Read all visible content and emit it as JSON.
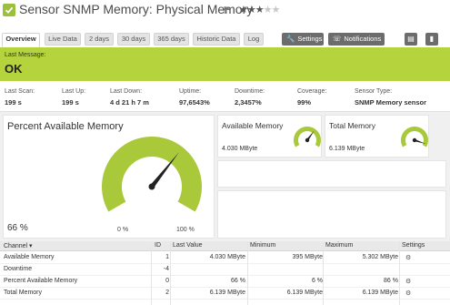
{
  "header": {
    "title": "Sensor SNMP Memory: Physical Memory",
    "status_icon": "check-icon",
    "flag_icon": "flag-icon",
    "priority": {
      "filled": 3,
      "total": 5,
      "filled_glyph": "★★★",
      "empty_glyph": "★★"
    },
    "colors": {
      "status_green": "#9bc03c",
      "banner_green": "#b5d33d",
      "gauge_green": "#a9c83a"
    }
  },
  "tabs": [
    "Overview",
    "Live Data",
    "2 days",
    "30 days",
    "365 days",
    "Historic Data",
    "Log"
  ],
  "toolbar": {
    "settings_label": "Settings",
    "notifications_label": "Notifications",
    "comment_icon": "comment-icon",
    "delete_icon": "trash-icon"
  },
  "banner": {
    "label": "Last Message:",
    "value": "OK"
  },
  "stats": [
    {
      "label": "Last Scan:",
      "value": "199 s"
    },
    {
      "label": "Last Up:",
      "value": "199 s"
    },
    {
      "label": "Last Down:",
      "value": "4 d 21 h 7 m"
    },
    {
      "label": "Uptime:",
      "value": "97,6543%"
    },
    {
      "label": "Downtime:",
      "value": "2,3457%"
    },
    {
      "label": "Coverage:",
      "value": "99%"
    },
    {
      "label": "Sensor Type:",
      "value": "SNMP Memory sensor"
    }
  ],
  "big_gauge": {
    "title": "Percent Available Memory",
    "value_label": "66 %",
    "min_label": "0 %",
    "max_label": "100 %",
    "fraction": 0.66
  },
  "small_gauges": [
    {
      "title": "Available Memory",
      "value": "4.030 MByte",
      "fraction": 0.65
    },
    {
      "title": "Total Memory",
      "value": "6.139 MByte",
      "fraction": 0.95
    }
  ],
  "table": {
    "headers": {
      "channel": "Channel",
      "id": "ID",
      "last": "Last Value",
      "min": "Minimum",
      "max": "Maximum",
      "settings": "Settings"
    },
    "rows": [
      {
        "channel": "Available Memory",
        "id": "1",
        "last": "4.030 MByte",
        "min": "395 MByte",
        "max": "5.302 MByte"
      },
      {
        "channel": "Downtime",
        "id": "-4",
        "last": "",
        "min": "",
        "max": ""
      },
      {
        "channel": "Percent Available Memory",
        "id": "0",
        "last": "66 %",
        "min": "6 %",
        "max": "86 %"
      },
      {
        "channel": "Total Memory",
        "id": "2",
        "last": "6.139 MByte",
        "min": "6.139 MByte",
        "max": "6.139 MByte"
      }
    ]
  }
}
